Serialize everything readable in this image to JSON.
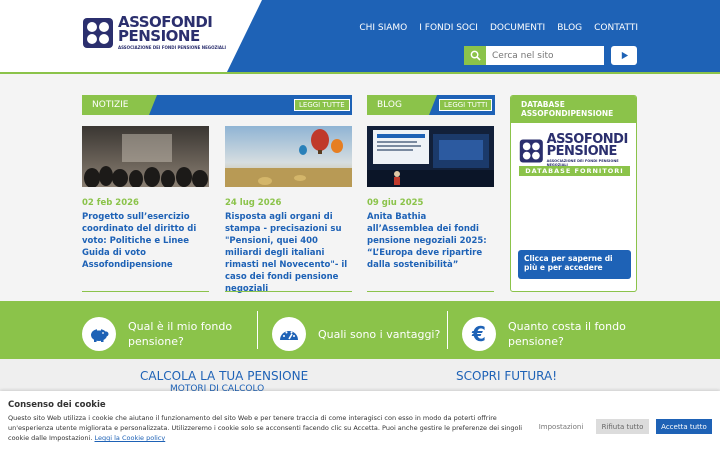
{
  "header": {
    "logo_line1": "ASSOFONDI",
    "logo_line2": "PENSIONE",
    "logo_line3": "ASSOCIAZIONE DEI FONDI PENSIONE NEGOZIALI",
    "nav": [
      "CHI SIAMO",
      "I FONDI SOCI",
      "DOCUMENTI",
      "BLOG",
      "CONTATTI"
    ],
    "search_placeholder": "Cerca nel sito",
    "search_icon": "search-icon",
    "go_icon": "play-icon"
  },
  "notizie": {
    "label": "NOTIZIE",
    "button": "LEGGI TUTTE",
    "cards": [
      {
        "date": "02 feb 2026",
        "title": "Progetto sull’esercizio coordinato del diritto di voto: Politiche e Linee Guida di voto Assofondipensione"
      },
      {
        "date": "24 lug 2026",
        "title": "Risposta agli organi di stampa - precisazioni su \"Pensioni, quei 400 miliardi degli italiani rimasti nel Novecento\"- il caso dei fondi pensione negoziali"
      }
    ]
  },
  "blog": {
    "label": "BLOG",
    "button": "LEGGI TUTTI",
    "cards": [
      {
        "date": "09 giu 2025",
        "title": "Anita Bathia all’Assemblea dei fondi pensione negoziali 2025: “L’Europa deve ripartire dalla sostenibilità”"
      }
    ]
  },
  "database": {
    "header": "DATABASE ASSOFONDIPENSIONE",
    "logo_line1": "ASSOFONDI",
    "logo_line2": "PENSIONE",
    "logo_line3": "ASSOCIAZIONE DEI FONDI PENSIONE NEGOZIALI",
    "banner": "DATABASE FORNITORI",
    "button": "Clicca per saperne di più e per accedere"
  },
  "green_band": [
    {
      "icon": "piggy-bank-icon",
      "text": "Qual è il mio fondo pensione?"
    },
    {
      "icon": "gauge-icon",
      "text": "Quali sono i vantaggi?"
    },
    {
      "icon": "euro-icon",
      "text": "Quanto costa il fondo pensione?"
    }
  ],
  "lower": {
    "calc_title": "CALCOLA LA TUA PENSIONE",
    "calc_sub": "MOTORI DI CALCOLO",
    "scopri": "SCOPRI FUTURA!"
  },
  "cookie": {
    "title": "Consenso dei cookie",
    "text": "Questo sito Web utilizza i cookie che aiutano il funzionamento del sito Web e per tenere traccia di come interagisci con esso in modo da poterti offrire un'esperienza utente migliorata e personalizzata. Utilizzeremo i cookie solo se acconsenti facendo clic su Accetta. Puoi anche gestire le preferenze dei singoli cookie dalle Impostazioni.",
    "link": "Leggi la Cookie policy",
    "settings": "Impostazioni",
    "reject": "Rifiuta tutto",
    "accept": "Accetta tutto"
  },
  "colors": {
    "blue": "#1e62b6",
    "green": "#8bc34a",
    "navy": "#2b2f6e"
  }
}
